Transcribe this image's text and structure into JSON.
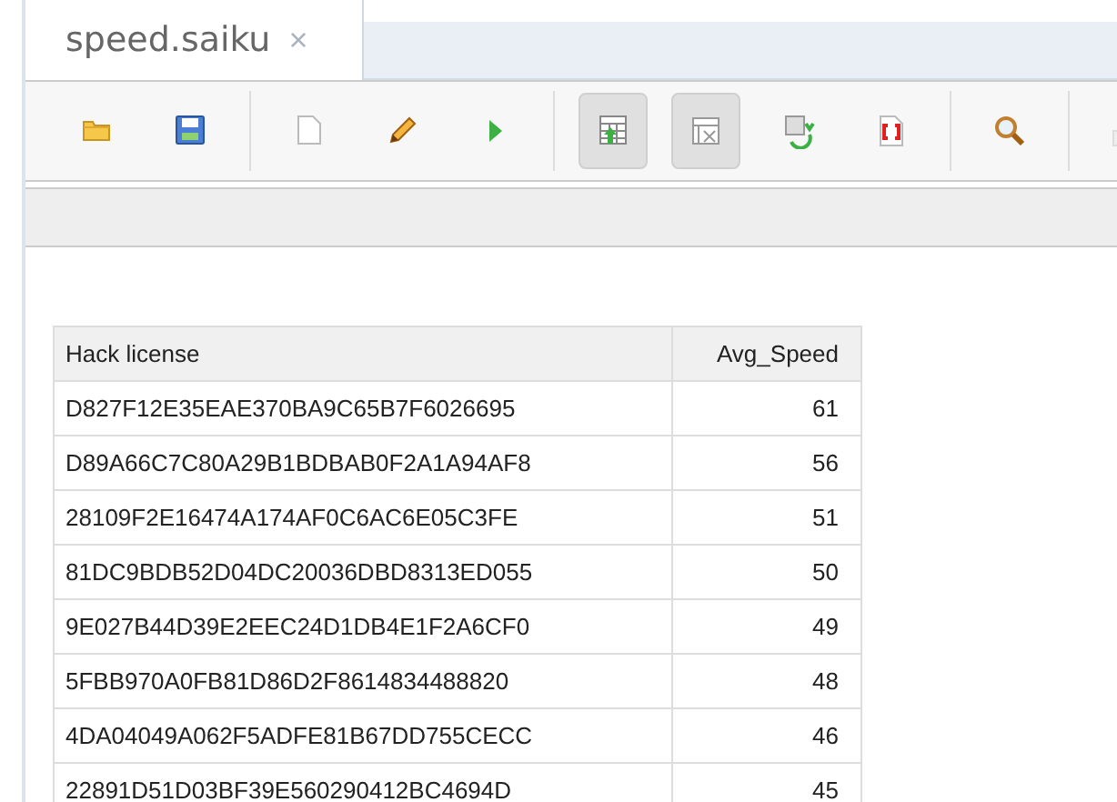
{
  "tab": {
    "title": "speed.saiku",
    "close": "×"
  },
  "toolbar": [
    {
      "kind": "button",
      "active": false
    },
    {
      "kind": "button",
      "active": false
    },
    {
      "kind": "separator"
    },
    {
      "kind": "button",
      "active": false
    },
    {
      "kind": "button",
      "active": false
    },
    {
      "kind": "button",
      "active": false
    },
    {
      "kind": "separator"
    },
    {
      "kind": "button",
      "active": true
    },
    {
      "kind": "button",
      "active": true
    },
    {
      "kind": "button",
      "active": false
    },
    {
      "kind": "button",
      "active": false
    },
    {
      "kind": "separator"
    },
    {
      "kind": "button",
      "active": false
    },
    {
      "kind": "separator"
    },
    {
      "kind": "button",
      "active": false
    }
  ],
  "table": {
    "columns": [
      "Hack license",
      "Avg_Speed"
    ],
    "rows": [
      [
        "D827F12E35EAE370BA9C65B7F6026695",
        "61"
      ],
      [
        "D89A66C7C80A29B1BDBAB0F2A1A94AF8",
        "56"
      ],
      [
        "28109F2E16474A174AF0C6AC6E05C3FE",
        "51"
      ],
      [
        "81DC9BDB52D04DC20036DBD8313ED055",
        "50"
      ],
      [
        "9E027B44D39E2EEC24D1DB4E1F2A6CF0",
        "49"
      ],
      [
        "5FBB970A0FB81D86D2F8614834488820",
        "48"
      ],
      [
        "4DA04049A062F5ADFE81B67DD755CECC",
        "46"
      ],
      [
        "22891D51D03BF39E560290412BC4694D",
        "45"
      ]
    ]
  }
}
